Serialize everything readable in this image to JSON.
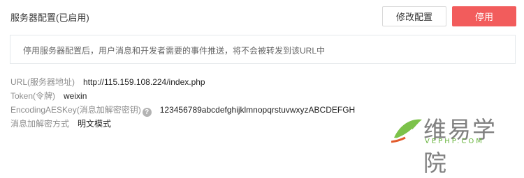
{
  "header": {
    "title": "服务器配置(已启用)",
    "modify_button": "修改配置",
    "disable_button": "停用"
  },
  "notice": {
    "text": "停用服务器配置后，用户消息和开发者需要的事件推送，将不会被转发到该URL中"
  },
  "config": {
    "url_label": "URL(服务器地址)",
    "url_value": "http://115.159.108.224/index.php",
    "token_label": "Token(令牌)",
    "token_value": "weixin",
    "aeskey_label": "EncodingAESKey(消息加解密密钥)",
    "aeskey_help": "?",
    "aeskey_value": "123456789abcdefghijklmnopqrstuvwxyzABCDEFGH",
    "encrypt_label": "消息加解密方式",
    "encrypt_value": "明文模式"
  },
  "watermark": {
    "cn": "维易学院",
    "en": "VEPHP.COM",
    "logo_icon": "leaf-logo-icon",
    "color_green": "#66b33a"
  },
  "colors": {
    "primary": "#f25c5c",
    "border": "#e4e8eb"
  }
}
